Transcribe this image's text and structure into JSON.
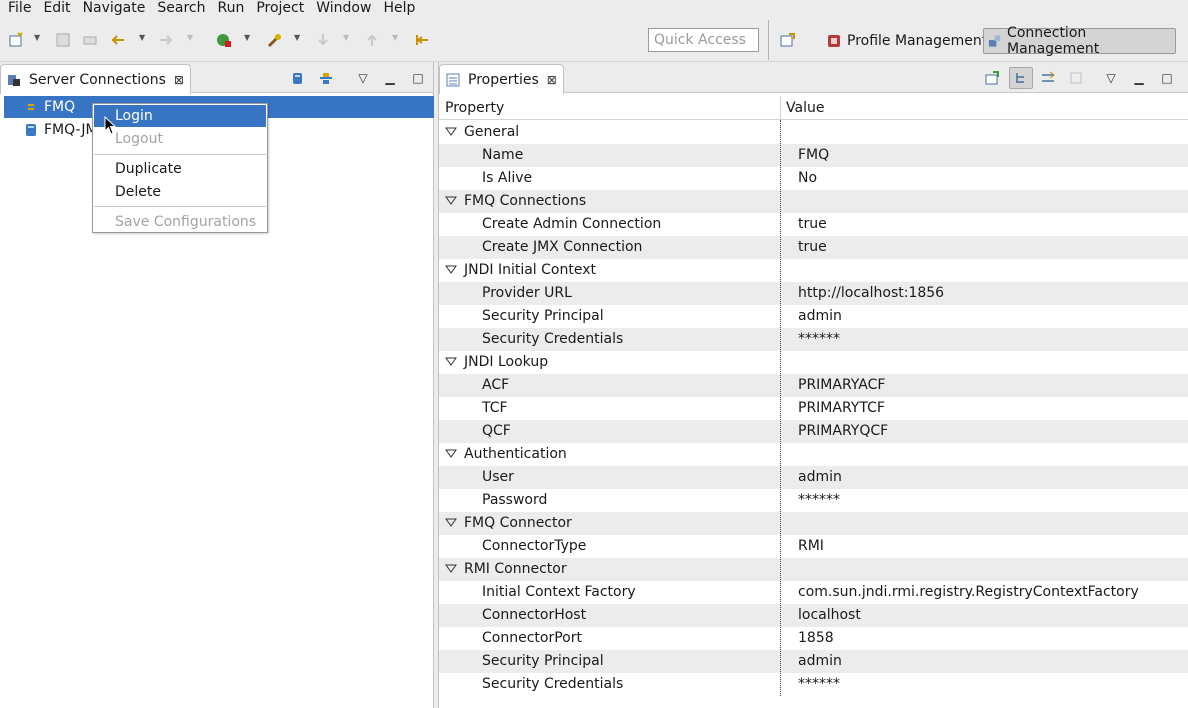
{
  "menu": [
    "File",
    "Edit",
    "Navigate",
    "Search",
    "Run",
    "Project",
    "Window",
    "Help"
  ],
  "toolbar": {
    "quick_access_placeholder": "Quick Access",
    "perspectives": [
      {
        "label": "Profile Management",
        "icon": "profile-icon",
        "active": false
      },
      {
        "label": "Connection Management",
        "icon": "connection-icon",
        "active": true
      }
    ]
  },
  "left_view": {
    "tab_title": "Server Connections",
    "tree": [
      {
        "label": "FMQ",
        "selected": true
      },
      {
        "label": "FMQ-JMX",
        "selected": false
      }
    ]
  },
  "context_menu": {
    "items": [
      {
        "label": "Login",
        "enabled": true,
        "highlighted": true
      },
      {
        "label": "Logout",
        "enabled": false
      },
      {
        "label": "Duplicate",
        "enabled": true
      },
      {
        "label": "Delete",
        "enabled": true
      },
      {
        "label": "Save Configurations",
        "enabled": false
      }
    ]
  },
  "right_view": {
    "tab_title": "Properties",
    "columns": [
      "Property",
      "Value"
    ],
    "sections": [
      {
        "name": "General",
        "rows": [
          {
            "key": "Name",
            "value": "FMQ"
          },
          {
            "key": "Is Alive",
            "value": "No"
          }
        ]
      },
      {
        "name": "FMQ Connections",
        "rows": [
          {
            "key": "Create Admin Connection",
            "value": "true"
          },
          {
            "key": "Create JMX Connection",
            "value": "true"
          }
        ]
      },
      {
        "name": "JNDI Initial Context",
        "rows": [
          {
            "key": "Provider URL",
            "value": "http://localhost:1856"
          },
          {
            "key": "Security Principal",
            "value": "admin"
          },
          {
            "key": "Security Credentials",
            "value": "******"
          }
        ]
      },
      {
        "name": "JNDI Lookup",
        "rows": [
          {
            "key": "ACF",
            "value": "PRIMARYACF"
          },
          {
            "key": "TCF",
            "value": "PRIMARYTCF"
          },
          {
            "key": "QCF",
            "value": "PRIMARYQCF"
          }
        ]
      },
      {
        "name": "Authentication",
        "rows": [
          {
            "key": "User",
            "value": "admin"
          },
          {
            "key": "Password",
            "value": "******"
          }
        ]
      },
      {
        "name": "FMQ Connector",
        "rows": [
          {
            "key": "ConnectorType",
            "value": "RMI"
          }
        ]
      },
      {
        "name": "RMI Connector",
        "rows": [
          {
            "key": "Initial Context Factory",
            "value": "com.sun.jndi.rmi.registry.RegistryContextFactory"
          },
          {
            "key": "ConnectorHost",
            "value": "localhost"
          },
          {
            "key": "ConnectorPort",
            "value": "1858"
          },
          {
            "key": "Security Principal",
            "value": "admin"
          },
          {
            "key": "Security Credentials",
            "value": "******"
          }
        ]
      }
    ]
  },
  "colors": {
    "selection": "#3874c4",
    "chrome": "#ececec",
    "row_alt": "#ececec"
  }
}
